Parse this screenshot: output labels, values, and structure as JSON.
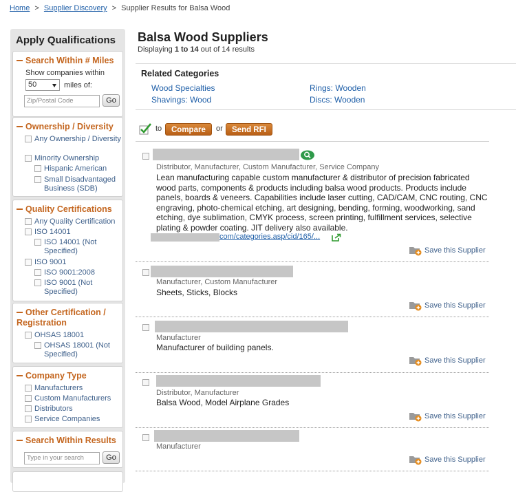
{
  "breadcrumb": {
    "home": "Home",
    "supplier_discovery": "Supplier Discovery",
    "current": "Supplier Results for Balsa Wood",
    "separator": ">"
  },
  "sidebar": {
    "title": "Apply Qualifications",
    "miles": {
      "title": "Search Within # Miles",
      "show_label": "Show companies within",
      "distance_value": "50",
      "miles_of": "miles of:",
      "zip_placeholder": "Zip/Postal Code",
      "go": "Go"
    },
    "ownership": {
      "title": "Ownership / Diversity",
      "any": "Any Ownership / Diversity",
      "minority": "Minority Ownership",
      "hispanic": "Hispanic American",
      "sdb": "Small Disadvantaged Business (SDB)"
    },
    "quality": {
      "title": "Quality Certifications",
      "any": "Any Quality Certification",
      "iso14001": "ISO 14001",
      "iso14001_ns": "ISO 14001 (Not Specified)",
      "iso9001": "ISO 9001",
      "iso9001_2008": "ISO 9001:2008",
      "iso9001_ns": "ISO 9001 (Not Specified)"
    },
    "other_cert": {
      "title": "Other Certification / Registration",
      "ohsas": "OHSAS 18001",
      "ohsas_ns": "OHSAS 18001 (Not Specified)"
    },
    "company_type": {
      "title": "Company Type",
      "items": [
        "Manufacturers",
        "Custom Manufacturers",
        "Distributors",
        "Service Companies"
      ]
    },
    "search_results": {
      "title": "Search Within Results",
      "placeholder": "Type in your search",
      "go": "Go"
    }
  },
  "main": {
    "title": "Balsa Wood Suppliers",
    "displaying_prefix": "Displaying",
    "displaying_range": "1 to 14",
    "displaying_suffix": "out of 14 results",
    "related_title": "Related Categories",
    "related": [
      "Wood Specialties",
      "Rings: Wooden",
      "Shavings: Wood",
      "Discs: Wooden"
    ],
    "action_to": "to",
    "compare": "Compare",
    "action_or": "or",
    "send_rfi": "Send RFI"
  },
  "results": [
    {
      "types": "Distributor, Manufacturer, Custom Manufacturer, Service Company",
      "description": "Lean manufacturing capable custom manufacturer & distributor of precision fabricated wood parts, components & products including balsa wood products. Products include panels, boards & veneers. Capabilities include laser cutting, CAD/CAM, CNC routing, CNC engraving, photo-chemical etching, art designing, bending, forming, woodworking, sand etching, dye sublimation, CMYK process, screen printing, fulfillment services, selective plating & powder coating. JIT delivery also available.",
      "url": "com/categories.asp/cid/165/...",
      "save": "Save this Supplier"
    },
    {
      "types": "Manufacturer, Custom Manufacturer",
      "description": "Sheets, Sticks, Blocks",
      "save": "Save this Supplier"
    },
    {
      "types": "Manufacturer",
      "description": "Manufacturer of building panels.",
      "save": "Save this Supplier"
    },
    {
      "types": "Distributor, Manufacturer",
      "description": "Balsa Wood, Model Airplane Grades",
      "save": "Save this Supplier"
    },
    {
      "types": "Manufacturer",
      "save": "Save this Supplier"
    }
  ],
  "colors": {
    "accent_orange": "#c4661f",
    "link_blue": "#1f5fa8",
    "sidebar_bg": "#e5e5e5"
  }
}
